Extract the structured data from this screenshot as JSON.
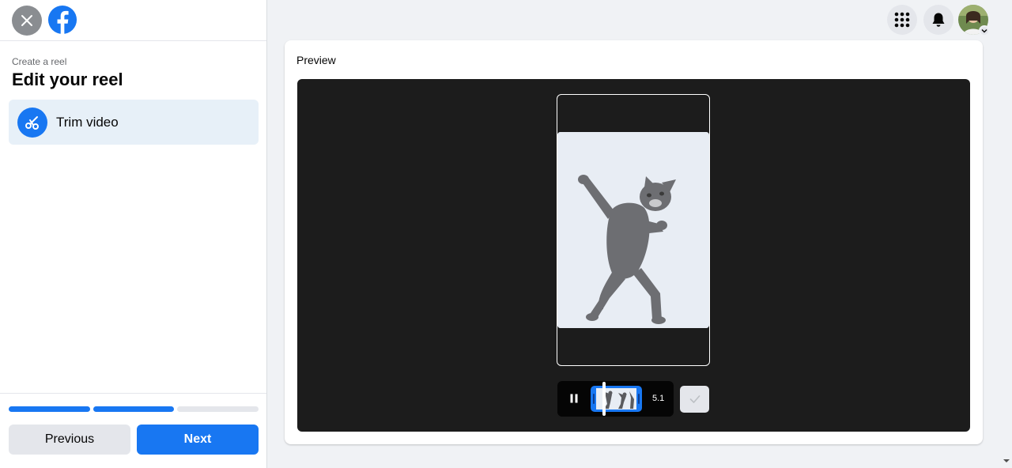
{
  "sidebar": {
    "breadcrumb": "Create a reel",
    "title": "Edit your reel",
    "tool": {
      "label": "Trim video",
      "icon": "scissors-icon"
    },
    "progress_steps": [
      true,
      true,
      false
    ],
    "buttons": {
      "previous": "Previous",
      "next": "Next"
    }
  },
  "header": {
    "icons": [
      "menu-grid-icon",
      "bell-icon",
      "avatar"
    ]
  },
  "preview": {
    "title": "Preview",
    "duration": "5.1",
    "controls_icons": [
      "pause-icon",
      "check-icon"
    ]
  },
  "colors": {
    "accent": "#1877f2",
    "stage": "#1c1c1c",
    "highlight": "#e7f0f8"
  }
}
